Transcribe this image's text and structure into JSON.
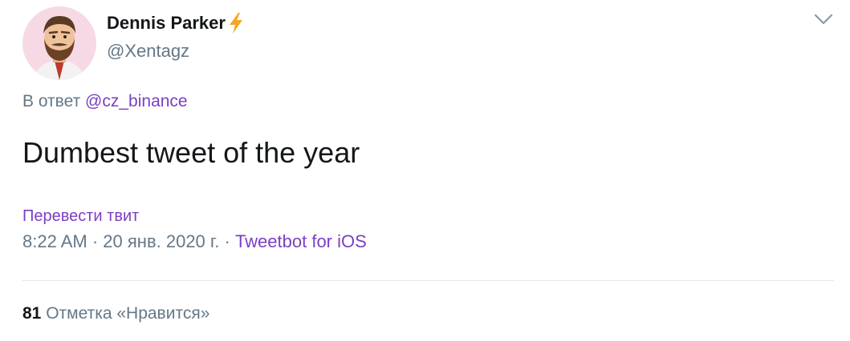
{
  "author": {
    "display_name": "Dennis Parker",
    "handle": "@Xentagz",
    "avatar_icon": "cartoon-bearded-man-avatar",
    "badge_icon": "lightning-bolt-icon",
    "avatar_bg": "#f7d9e6"
  },
  "menu": {
    "icon": "chevron-down-icon"
  },
  "reply": {
    "prefix": "В ответ",
    "mention": "@cz_binance"
  },
  "tweet": {
    "text": "Dumbest tweet of the year"
  },
  "translate_label": "Перевести твит",
  "meta": {
    "time": "8:22 AM",
    "separator": "·",
    "date": "20 янв. 2020 г.",
    "separator2": "·",
    "source": "Tweetbot for iOS"
  },
  "stats": {
    "likes_count": "81",
    "likes_label": "Отметка «Нравится»"
  },
  "colors": {
    "accent": "#7b3fc4",
    "secondary_text": "#657786",
    "primary_text": "#14171a",
    "divider": "#e1e8ed",
    "bolt": "#f5a623"
  }
}
